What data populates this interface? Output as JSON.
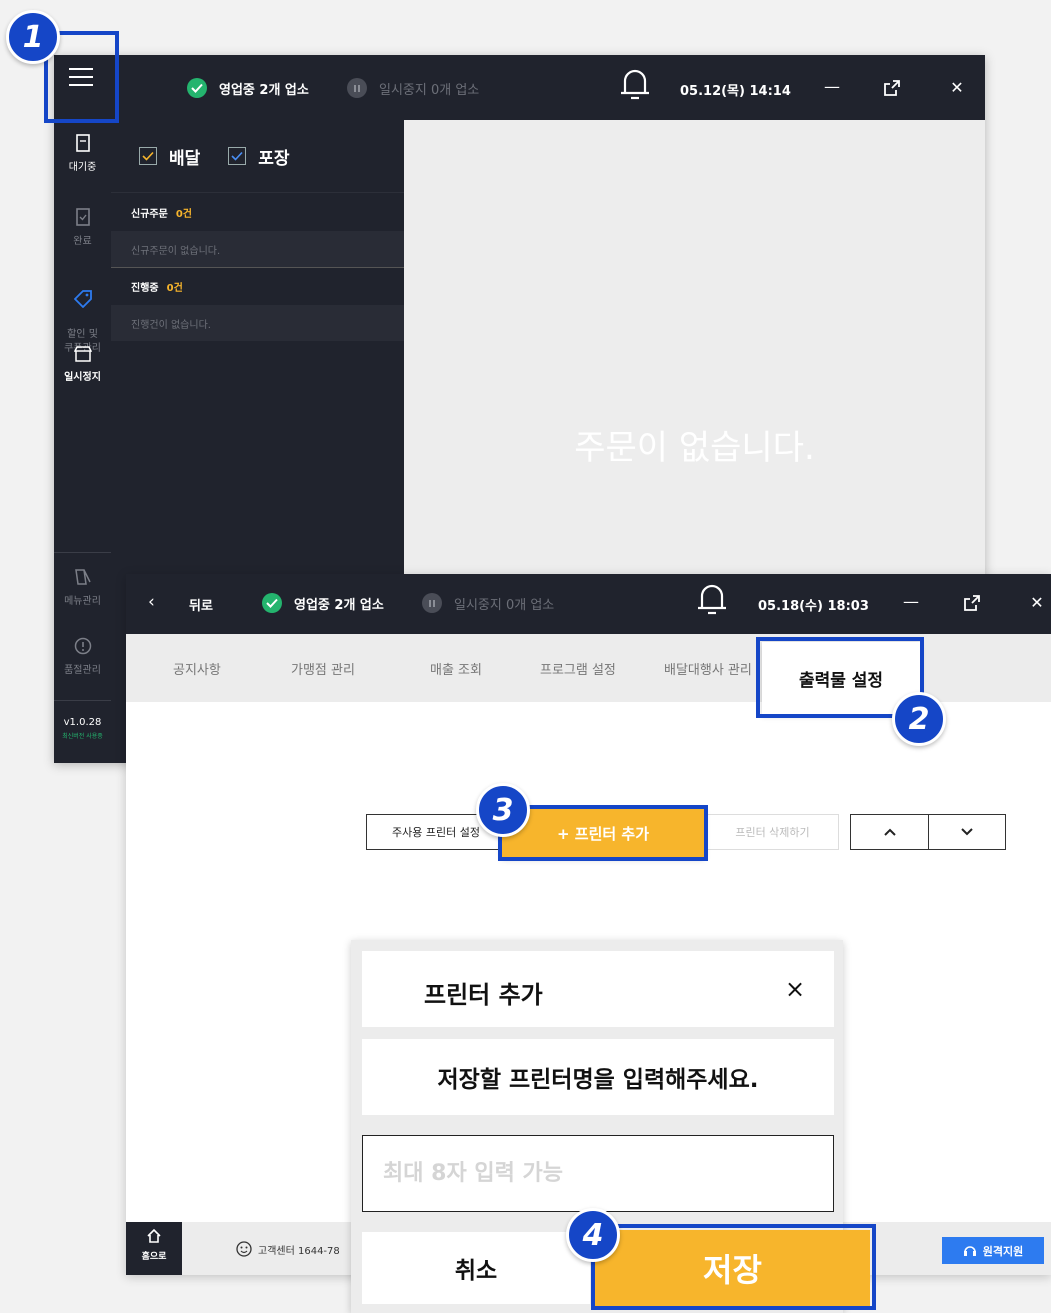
{
  "window1": {
    "status_open": "영업중 2개 업소",
    "status_paused": "일시중지 0개 업소",
    "datetime": "05.12(목) 14:14",
    "sidebar": [
      {
        "label": "대기중",
        "icon": "receipt-icon"
      },
      {
        "label": "완료",
        "icon": "check-receipt-icon"
      },
      {
        "label": "할인 및\n쿠폰관리",
        "icon": "tag-icon"
      },
      {
        "label": "일시정지",
        "icon": "store-icon"
      },
      {
        "label": "메뉴관리",
        "icon": "menu-book-icon"
      },
      {
        "label": "품절관리",
        "icon": "alert-icon"
      }
    ],
    "version": "v1.0.28",
    "version_sub": "최신버전 사용중",
    "filters": {
      "delivery": "배달",
      "takeout": "포장"
    },
    "new_orders_label": "신규주문",
    "new_orders_count": "0건",
    "new_orders_empty": "신규주문이 없습니다.",
    "in_progress_label": "진행중",
    "in_progress_count": "0건",
    "in_progress_empty": "진행건이 없습니다.",
    "main_empty": "주문이 없습니다."
  },
  "window2": {
    "back_label": "뒤로",
    "status_open": "영업중 2개 업소",
    "status_paused": "일시중지 0개 업소",
    "datetime": "05.18(수) 18:03",
    "tabs": [
      "공지사항",
      "가맹점 관리",
      "매출 조회",
      "프로그램 설정",
      "배달대행사 관리",
      "출력물 설정"
    ],
    "main_printer_btn": "주사용 프린터 설정",
    "add_printer_btn": "+ 프린터 추가",
    "delete_printer_btn": "프린터 삭제하기",
    "home_label": "홈으로",
    "support_label": "고객센터 1644-78",
    "remote_label": "원격지원"
  },
  "modal": {
    "title": "프린터 추가",
    "close": "×",
    "prompt": "저장할 프린터명을 입력해주세요.",
    "input_placeholder": "최대 8자 입력 가능",
    "cancel": "취소",
    "save": "저장"
  },
  "annotations": [
    "1",
    "2",
    "3",
    "4"
  ],
  "colors": {
    "accent": "#f7b52c",
    "highlight": "#1546c7",
    "dark": "#20232d",
    "green": "#24b46e"
  }
}
